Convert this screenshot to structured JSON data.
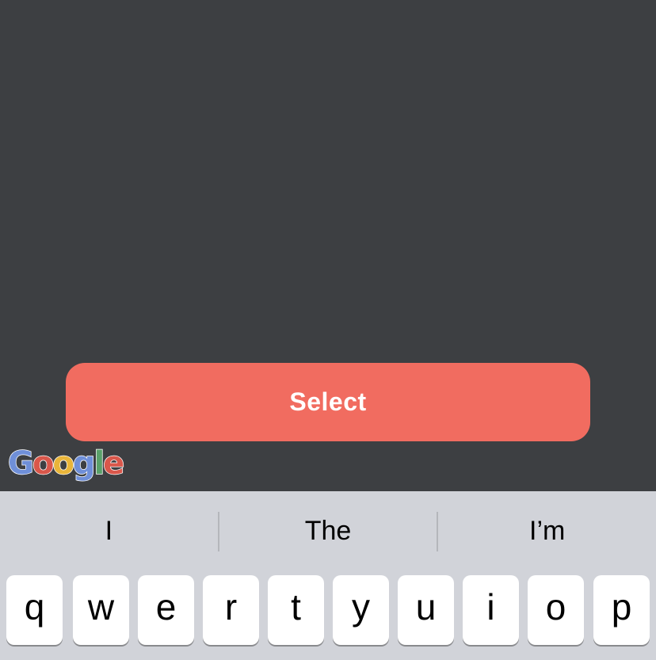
{
  "map": {
    "background_color": "#3d3f42",
    "attribution_text": "Google",
    "attribution_letters": [
      "G",
      "o",
      "o",
      "g",
      "l",
      "e"
    ]
  },
  "action": {
    "select_label": "Select",
    "button_color": "#f16c60"
  },
  "keyboard": {
    "suggestions": [
      "I",
      "The",
      "I’m"
    ],
    "row1": [
      "q",
      "w",
      "e",
      "r",
      "t",
      "y",
      "u",
      "i",
      "o",
      "p"
    ]
  }
}
